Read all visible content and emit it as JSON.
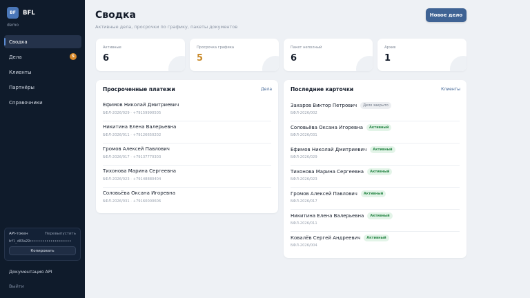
{
  "sidebar": {
    "logo_text": "BF",
    "brand": "BFL",
    "workspace": "demo",
    "items": [
      {
        "label": "Сводка",
        "active": true
      },
      {
        "label": "Дела",
        "badge": "5"
      },
      {
        "label": "Клиенты"
      },
      {
        "label": "Партнёры"
      },
      {
        "label": "Справочники"
      }
    ],
    "token": {
      "label": "API-токен",
      "regenerate": "Перевыпустить",
      "value": "bfl_d83a29••••••••••••••••••••",
      "copy": "Копировать"
    },
    "api_docs": "Документация API",
    "logout": "Выйти"
  },
  "header": {
    "title": "Сводка",
    "subtitle": "Активные дела, просрочки по графику, пакеты документов",
    "new_case": "Новое дело"
  },
  "stats": [
    {
      "label": "Активные",
      "value": "6"
    },
    {
      "label": "Просрочка графика",
      "value": "5",
      "color": "#c98a2a"
    },
    {
      "label": "Пакет неполный",
      "value": "6"
    },
    {
      "label": "Архив",
      "value": "1"
    }
  ],
  "overdue": {
    "title": "Просроченные платежи",
    "link": "Дела",
    "rows": [
      {
        "name": "Ефимов Николай Дмитриевич",
        "sub": "БФЛ-2026/029 · +79159990505"
      },
      {
        "name": "Никитина Елена Валерьевна",
        "sub": "БФЛ-2026/011 · +79126650202"
      },
      {
        "name": "Громов Алексей Павлович",
        "sub": "БФЛ-2026/017 · +79137770303"
      },
      {
        "name": "Тихонова Марина Сергеевна",
        "sub": "БФЛ-2026/023 · +79148880404"
      },
      {
        "name": "Соловьёва Оксана Игоревна",
        "sub": "БФЛ-2026/031 · +79160000606"
      }
    ]
  },
  "recent": {
    "title": "Последние карточки",
    "link": "Клиенты",
    "rows": [
      {
        "name": "Захаров Виктор Петрович",
        "status": "Дело закрыто",
        "kind": "closed",
        "sub": "БФЛ-2026/002"
      },
      {
        "name": "Соловьёва Оксана Игоревна",
        "status": "Активный",
        "kind": "active",
        "sub": "БФЛ-2026/031"
      },
      {
        "name": "Ефимов Николай Дмитриевич",
        "status": "Активный",
        "kind": "active",
        "sub": "БФЛ-2026/029"
      },
      {
        "name": "Тихонова Марина Сергеевна",
        "status": "Активный",
        "kind": "active",
        "sub": "БФЛ-2026/023"
      },
      {
        "name": "Громов Алексей Павлович",
        "status": "Активный",
        "kind": "active",
        "sub": "БФЛ-2026/017"
      },
      {
        "name": "Никитина Елена Валерьевна",
        "status": "Активный",
        "kind": "active",
        "sub": "БФЛ-2026/011"
      },
      {
        "name": "Ковалёв Сергей Андреевич",
        "status": "Активный",
        "kind": "active",
        "sub": "БФЛ-2026/004"
      }
    ]
  }
}
